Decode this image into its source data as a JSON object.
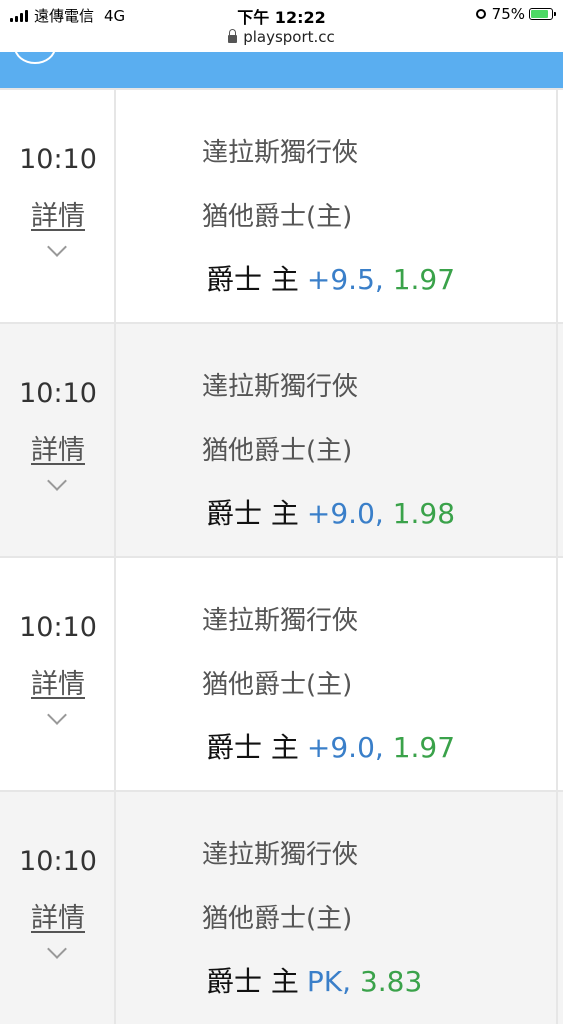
{
  "status_bar": {
    "carrier": "遠傳電信",
    "network": "4G",
    "time": "下午 12:22",
    "url": "playsport.cc",
    "battery": "75%"
  },
  "games": [
    {
      "time": "10:10",
      "detail_label": "詳情",
      "away_team": "達拉斯獨行俠",
      "home_team": "猶他爵士(主)",
      "pick_team": "爵士 主",
      "line": "+9.5",
      "odds": "1.97"
    },
    {
      "time": "10:10",
      "detail_label": "詳情",
      "away_team": "達拉斯獨行俠",
      "home_team": "猶他爵士(主)",
      "pick_team": "爵士 主",
      "line": "+9.0",
      "odds": "1.98"
    },
    {
      "time": "10:10",
      "detail_label": "詳情",
      "away_team": "達拉斯獨行俠",
      "home_team": "猶他爵士(主)",
      "pick_team": "爵士 主",
      "line": "+9.0",
      "odds": "1.97"
    },
    {
      "time": "10:10",
      "detail_label": "詳情",
      "away_team": "達拉斯獨行俠",
      "home_team": "猶他爵士(主)",
      "pick_team": "爵士 主",
      "line": "PK",
      "odds": "3.83"
    }
  ],
  "colors": {
    "header_blue": "#5aaef0",
    "line_blue": "#3a7fc9",
    "odds_green": "#3aa24a"
  }
}
